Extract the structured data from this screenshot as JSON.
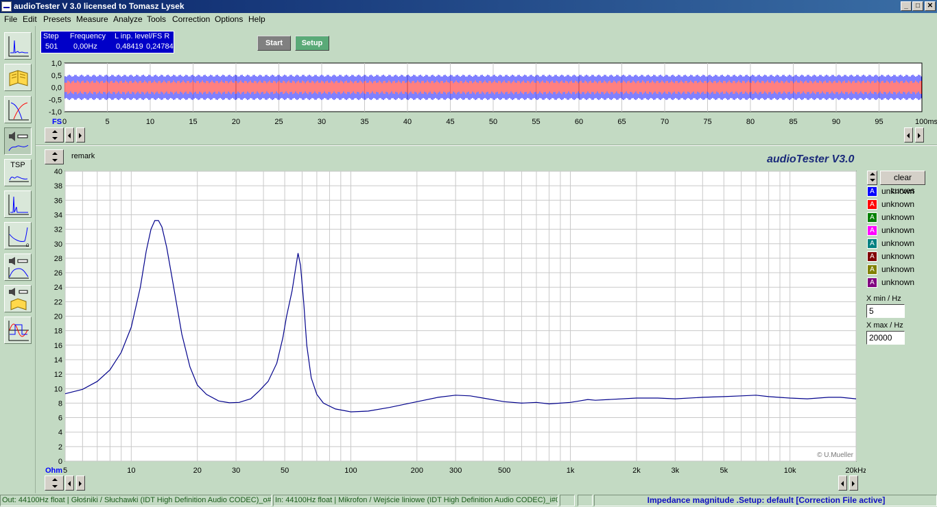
{
  "window": {
    "title": "audioTester  V 3.0   licensed to Tomasz Lysek"
  },
  "menu": [
    "File",
    "Edit",
    "Presets",
    "Measure",
    "Analyze",
    "Tools",
    "Correction",
    "Options",
    "Help"
  ],
  "info": {
    "step_label": "Step",
    "freq_label": "Frequency",
    "level_label": "L  inp. level/FS  R",
    "step": "501",
    "freq": "0,00Hz",
    "left": "0,48419",
    "right": "0,24784"
  },
  "buttons": {
    "start": "Start",
    "setup": "Setup",
    "clear": "clear curves"
  },
  "scope": {
    "y_ticks": [
      "1,0",
      "0,5",
      "0,0",
      "-0,5",
      "-1,0"
    ],
    "fs_label": "FS",
    "x_ticks": [
      "0",
      "5",
      "10",
      "15",
      "20",
      "25",
      "30",
      "35",
      "40",
      "45",
      "50",
      "55",
      "60",
      "65",
      "70",
      "75",
      "80",
      "85",
      "90",
      "95"
    ],
    "x_end": "100ms"
  },
  "remark": "remark",
  "brand": "audioTester  V3.0",
  "copyright": "© U.Mueller",
  "legend": [
    {
      "label": "unknown",
      "color": "#0000ff"
    },
    {
      "label": "unknown",
      "color": "#ff0000"
    },
    {
      "label": "unknown",
      "color": "#008000"
    },
    {
      "label": "unknown",
      "color": "#ff00ff"
    },
    {
      "label": "unknown",
      "color": "#008080"
    },
    {
      "label": "unknown",
      "color": "#800000"
    },
    {
      "label": "unknown",
      "color": "#808000"
    },
    {
      "label": "unknown",
      "color": "#800080"
    }
  ],
  "xmin": {
    "label": "X min / Hz",
    "value": "5"
  },
  "xmax": {
    "label": "X max / Hz",
    "value": "20000"
  },
  "chart_data": {
    "type": "line",
    "ylabel": "Ohm",
    "ylim": [
      0,
      40
    ],
    "y_ticks": [
      0,
      2,
      4,
      6,
      8,
      10,
      12,
      14,
      16,
      18,
      20,
      22,
      24,
      26,
      28,
      30,
      32,
      34,
      36,
      38,
      40
    ],
    "xscale": "log",
    "xlim": [
      5,
      20000
    ],
    "x_tick_labels": [
      {
        "v": 5,
        "t": "5"
      },
      {
        "v": 10,
        "t": "10"
      },
      {
        "v": 20,
        "t": "20"
      },
      {
        "v": 30,
        "t": "30"
      },
      {
        "v": 50,
        "t": "50"
      },
      {
        "v": 100,
        "t": "100"
      },
      {
        "v": 200,
        "t": "200"
      },
      {
        "v": 300,
        "t": "300"
      },
      {
        "v": 500,
        "t": "500"
      },
      {
        "v": 1000,
        "t": "1k"
      },
      {
        "v": 2000,
        "t": "2k"
      },
      {
        "v": 3000,
        "t": "3k"
      },
      {
        "v": 5000,
        "t": "5k"
      },
      {
        "v": 10000,
        "t": "10k"
      },
      {
        "v": 20000,
        "t": "20kHz"
      }
    ],
    "grid": true,
    "series": [
      {
        "color": "#00008b",
        "points": [
          [
            5,
            9.3
          ],
          [
            6,
            9.9
          ],
          [
            7,
            11.0
          ],
          [
            8,
            12.6
          ],
          [
            9,
            15.0
          ],
          [
            10,
            18.5
          ],
          [
            11,
            24.0
          ],
          [
            11.7,
            29.0
          ],
          [
            12.3,
            32.0
          ],
          [
            12.8,
            33.2
          ],
          [
            13.3,
            33.2
          ],
          [
            13.8,
            32.3
          ],
          [
            14.5,
            29.5
          ],
          [
            15.5,
            24.5
          ],
          [
            17,
            17.5
          ],
          [
            18.5,
            13.0
          ],
          [
            20,
            10.5
          ],
          [
            22,
            9.2
          ],
          [
            25,
            8.3
          ],
          [
            28,
            8.05
          ],
          [
            31,
            8.1
          ],
          [
            35,
            8.6
          ],
          [
            38,
            9.6
          ],
          [
            42,
            11.0
          ],
          [
            46,
            13.5
          ],
          [
            49,
            17.0
          ],
          [
            51,
            20.0
          ],
          [
            54,
            23.5
          ],
          [
            56,
            26.5
          ],
          [
            57.5,
            28.7
          ],
          [
            59,
            27.0
          ],
          [
            61,
            22.0
          ],
          [
            63,
            16.0
          ],
          [
            66,
            11.5
          ],
          [
            70,
            9.2
          ],
          [
            75,
            8.0
          ],
          [
            85,
            7.2
          ],
          [
            100,
            6.8
          ],
          [
            120,
            6.9
          ],
          [
            150,
            7.4
          ],
          [
            200,
            8.2
          ],
          [
            250,
            8.8
          ],
          [
            300,
            9.1
          ],
          [
            350,
            9.0
          ],
          [
            400,
            8.7
          ],
          [
            500,
            8.2
          ],
          [
            600,
            8.0
          ],
          [
            700,
            8.1
          ],
          [
            800,
            7.9
          ],
          [
            900,
            8.0
          ],
          [
            1000,
            8.1
          ],
          [
            1100,
            8.3
          ],
          [
            1200,
            8.5
          ],
          [
            1300,
            8.4
          ],
          [
            1500,
            8.5
          ],
          [
            2000,
            8.7
          ],
          [
            2500,
            8.7
          ],
          [
            3000,
            8.6
          ],
          [
            4000,
            8.8
          ],
          [
            5000,
            8.9
          ],
          [
            6000,
            9.0
          ],
          [
            7000,
            9.1
          ],
          [
            8000,
            8.9
          ],
          [
            10000,
            8.7
          ],
          [
            12000,
            8.6
          ],
          [
            15000,
            8.8
          ],
          [
            17000,
            8.8
          ],
          [
            20000,
            8.6
          ]
        ]
      }
    ]
  },
  "status": {
    "out": "Out: 44100Hz float  | Głośniki / Słuchawki (IDT High Definition Audio CODEC)_o#0",
    "in": "In: 44100Hz float  | Mikrofon / Wejście liniowe (IDT High Definition Audio CODEC)_i#0",
    "mode": "Impedance magnitude  .Setup:  default  [Correction File active]"
  }
}
